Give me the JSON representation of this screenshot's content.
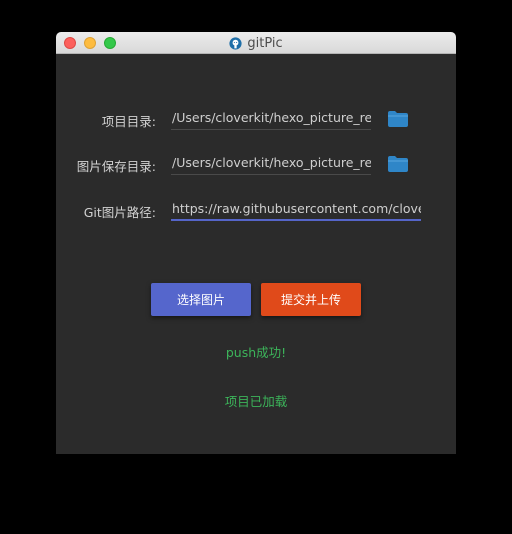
{
  "window": {
    "title": "gitPic"
  },
  "form": {
    "project_dir": {
      "label": "项目目录:",
      "value": "/Users/cloverkit/hexo_picture_re"
    },
    "save_dir": {
      "label": "图片保存目录:",
      "value": "/Users/cloverkit/hexo_picture_re"
    },
    "git_path": {
      "label": "Git图片路径:",
      "value": "https://raw.githubusercontent.com/clove"
    }
  },
  "buttons": {
    "select_label": "选择图片",
    "upload_label": "提交并上传"
  },
  "status": {
    "push_message": "push成功!",
    "project_message": "项目已加载"
  },
  "colors": {
    "background": "#2b2b2b",
    "select_button": "#5566cc",
    "upload_button": "#e04a1a",
    "status_text": "#3cb45a",
    "folder_icon": "#2f86c8",
    "focus_underline": "#5565c9"
  },
  "icons": {
    "app": "github-octocat-icon",
    "folder": "folder-icon"
  }
}
